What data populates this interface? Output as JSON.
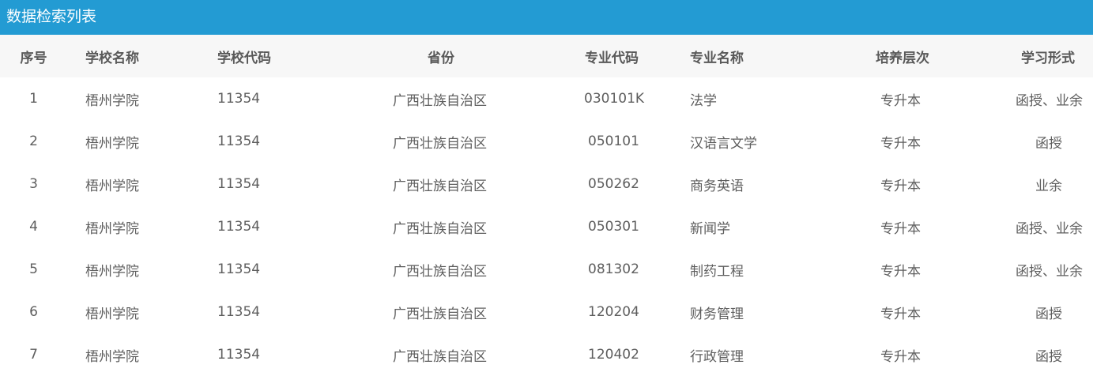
{
  "panel": {
    "title": "数据检索列表",
    "accent_color": "#239bd3",
    "header_bg": "#f7f7f7"
  },
  "table": {
    "columns": [
      "序号",
      "学校名称",
      "学校代码",
      "省份",
      "专业代码",
      "专业名称",
      "培养层次",
      "学习形式"
    ],
    "rows": [
      [
        "1",
        "梧州学院",
        "11354",
        "广西壮族自治区",
        "030101K",
        "法学",
        "专升本",
        "函授、业余"
      ],
      [
        "2",
        "梧州学院",
        "11354",
        "广西壮族自治区",
        "050101",
        "汉语言文学",
        "专升本",
        "函授"
      ],
      [
        "3",
        "梧州学院",
        "11354",
        "广西壮族自治区",
        "050262",
        "商务英语",
        "专升本",
        "业余"
      ],
      [
        "4",
        "梧州学院",
        "11354",
        "广西壮族自治区",
        "050301",
        "新闻学",
        "专升本",
        "函授、业余"
      ],
      [
        "5",
        "梧州学院",
        "11354",
        "广西壮族自治区",
        "081302",
        "制药工程",
        "专升本",
        "函授、业余"
      ],
      [
        "6",
        "梧州学院",
        "11354",
        "广西壮族自治区",
        "120204",
        "财务管理",
        "专升本",
        "函授"
      ],
      [
        "7",
        "梧州学院",
        "11354",
        "广西壮族自治区",
        "120402",
        "行政管理",
        "专升本",
        "函授"
      ]
    ]
  }
}
